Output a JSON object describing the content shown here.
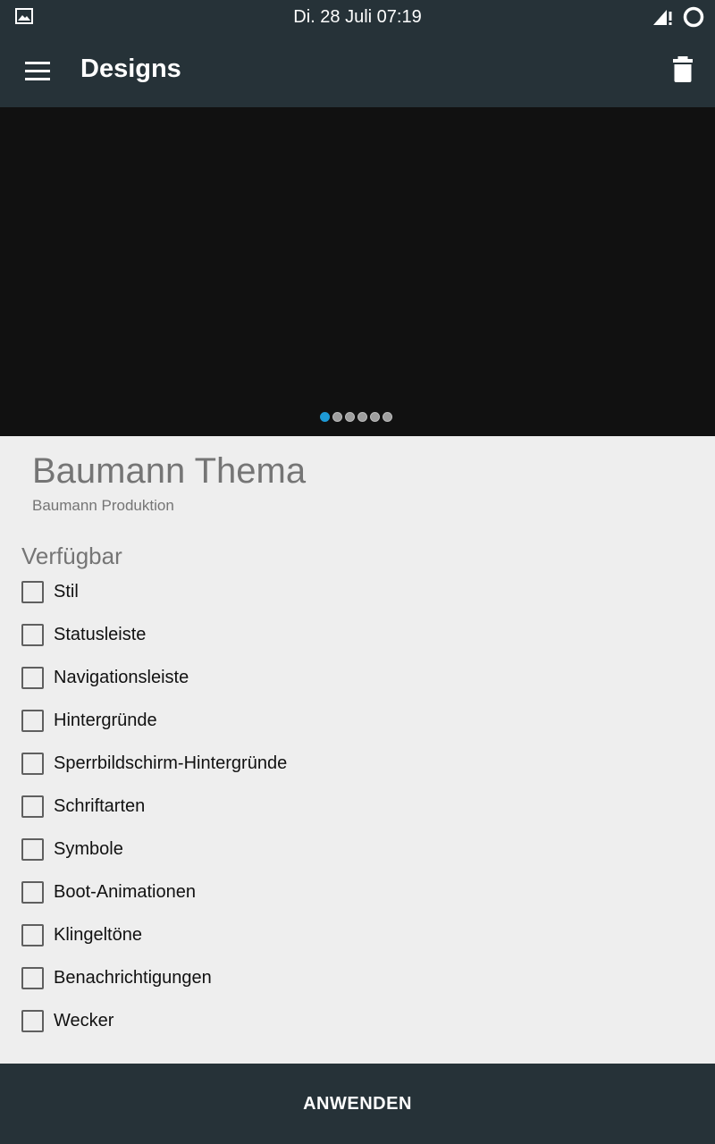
{
  "status_bar": {
    "time": "Di. 28 Juli 07:19",
    "left_icon": "gallery-icon",
    "right_icons": [
      "signal-icon",
      "battery-icon"
    ]
  },
  "app_bar": {
    "title": "Designs",
    "menu_icon": "menu-icon",
    "action_icon": "delete-icon"
  },
  "preview": {
    "page_count": 6,
    "active_page": 1
  },
  "theme": {
    "name": "Baumann Thema",
    "author": "Baumann Produktion"
  },
  "available": {
    "title": "Verfügbar",
    "items": [
      {
        "label": "Stil",
        "checked": false
      },
      {
        "label": "Statusleiste",
        "checked": false
      },
      {
        "label": "Navigationsleiste",
        "checked": false
      },
      {
        "label": "Hintergründe",
        "checked": false
      },
      {
        "label": "Sperrbildschirm-Hintergründe",
        "checked": false
      },
      {
        "label": "Schriftarten",
        "checked": false
      },
      {
        "label": "Symbole",
        "checked": false
      },
      {
        "label": "Boot-Animationen",
        "checked": false
      },
      {
        "label": "Klingeltöne",
        "checked": false
      },
      {
        "label": "Benachrichtigungen",
        "checked": false
      },
      {
        "label": "Wecker",
        "checked": false
      }
    ]
  },
  "footer": {
    "apply_label": "ANWENDEN"
  },
  "colors": {
    "bar_background": "#263238",
    "preview_background": "#111111",
    "page_background": "#eeeeee",
    "indicator_active": "#1e9ad6",
    "secondary_text": "#757575"
  }
}
